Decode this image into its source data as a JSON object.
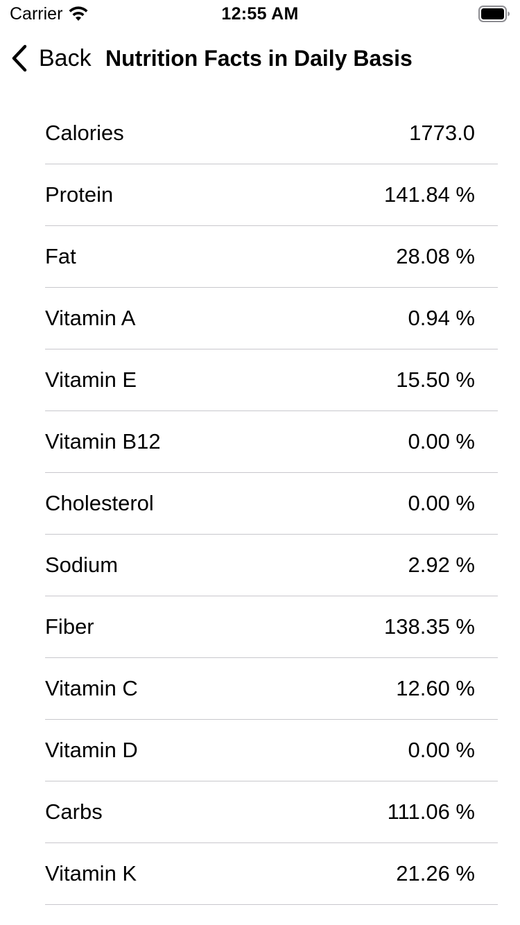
{
  "status_bar": {
    "carrier": "Carrier",
    "time": "12:55 AM",
    "wifi_icon": "wifi-icon",
    "battery_icon": "battery-icon"
  },
  "nav": {
    "back_label": "Back",
    "back_icon": "chevron-left-icon",
    "title": "Nutrition Facts in Daily Basis"
  },
  "rows": [
    {
      "label": "Calories",
      "value": "1773.0"
    },
    {
      "label": "Protein",
      "value": "141.84 %"
    },
    {
      "label": "Fat",
      "value": "28.08 %"
    },
    {
      "label": "Vitamin A",
      "value": "0.94 %"
    },
    {
      "label": "Vitamin E",
      "value": "15.50 %"
    },
    {
      "label": "Vitamin B12",
      "value": "0.00 %"
    },
    {
      "label": "Cholesterol",
      "value": "0.00 %"
    },
    {
      "label": "Sodium",
      "value": "2.92 %"
    },
    {
      "label": "Fiber",
      "value": "138.35 %"
    },
    {
      "label": "Vitamin C",
      "value": "12.60 %"
    },
    {
      "label": "Vitamin D",
      "value": "0.00 %"
    },
    {
      "label": "Carbs",
      "value": "111.06 %"
    },
    {
      "label": "Vitamin K",
      "value": "21.26 %"
    }
  ],
  "colors": {
    "background": "#ffffff",
    "text": "#000000",
    "separator": "#c8c7cc"
  }
}
